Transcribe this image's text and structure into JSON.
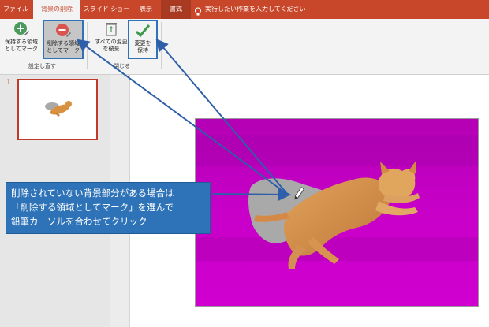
{
  "tabs": {
    "file": "ファイル",
    "remove_bg": "背景の削除",
    "slideshow": "スライド ショー",
    "view": "表示",
    "format": "書式"
  },
  "tell_me": "実行したい作業を入力してください",
  "ribbon": {
    "mark_keep_line1": "保持する領域",
    "mark_keep_line2": "としてマーク",
    "mark_remove_line1": "削除する領域",
    "mark_remove_line2": "としてマーク",
    "discard_line1": "すべての変更",
    "discard_line2": "を破棄",
    "keep_changes_line1": "変更を",
    "keep_changes_line2": "保持",
    "group_refine": "設定し直す",
    "group_close": "閉じる"
  },
  "slides": {
    "number": "1"
  },
  "callout": {
    "line1": "削除されていない背景部分がある場合は",
    "line2": "「削除する領域としてマーク」を選んで",
    "line3": "鉛筆カーソルを合わせてクリック"
  },
  "colors": {
    "accent": "#c8472a",
    "highlight": "#2e73b8",
    "removal_overlay": "#c800c8"
  }
}
